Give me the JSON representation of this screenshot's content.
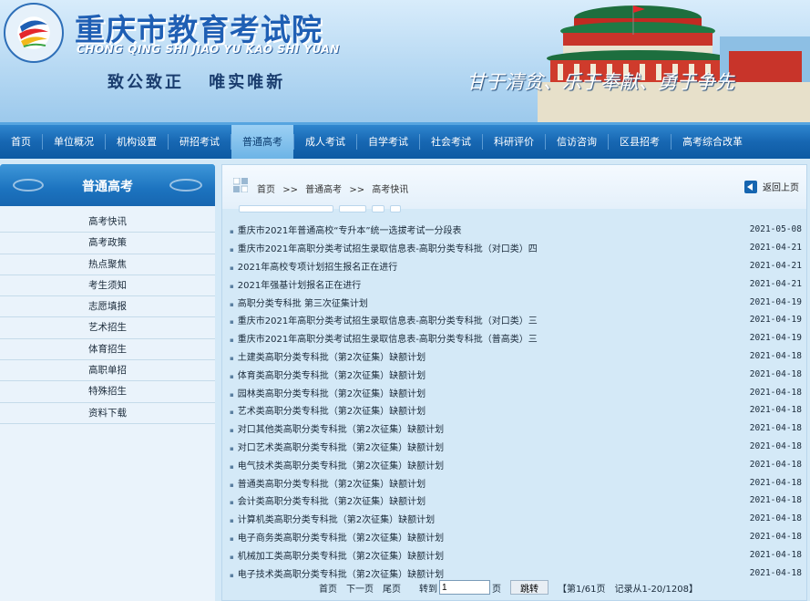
{
  "header": {
    "title": "重庆市教育考试院",
    "pinyin": "CHONG QING SHI JIAO YU KAO SHI YUAN",
    "motto_left": "致公致正 唯实唯新",
    "motto_right": "甘于清贫、乐于奉献、勇于争先"
  },
  "nav": {
    "items": [
      "首页",
      "单位概况",
      "机构设置",
      "研招考试",
      "普通高考",
      "成人考试",
      "自学考试",
      "社会考试",
      "科研评价",
      "信访咨询",
      "区县招考",
      "高考综合改革"
    ],
    "active_index": 4
  },
  "sidebar": {
    "title": "普通高考",
    "items": [
      "高考快讯",
      "高考政策",
      "热点聚焦",
      "考生须知",
      "志愿填报",
      "艺术招生",
      "体育招生",
      "高职单招",
      "特殊招生",
      "资料下载"
    ]
  },
  "breadcrumb": {
    "home": "首页",
    "sep": ">>",
    "level1": "普通高考",
    "level2": "高考快讯",
    "back_label": "返回上页"
  },
  "news": [
    {
      "title": "重庆市2021年普通高校“专升本”统一选拔考试一分段表",
      "date": "2021-05-08"
    },
    {
      "title": "重庆市2021年高职分类考试招生录取信息表-高职分类专科批（对口类）四",
      "date": "2021-04-21"
    },
    {
      "title": "2021年高校专项计划招生报名正在进行",
      "date": "2021-04-21"
    },
    {
      "title": "2021年强基计划报名正在进行",
      "date": "2021-04-21"
    },
    {
      "title": "高职分类专科批 第三次征集计划",
      "date": "2021-04-19"
    },
    {
      "title": "重庆市2021年高职分类考试招生录取信息表-高职分类专科批（对口类）三",
      "date": "2021-04-19"
    },
    {
      "title": "重庆市2021年高职分类考试招生录取信息表-高职分类专科批（普高类）三",
      "date": "2021-04-19"
    },
    {
      "title": "土建类高职分类专科批（第2次征集）缺额计划",
      "date": "2021-04-18"
    },
    {
      "title": "体育类高职分类专科批（第2次征集）缺额计划",
      "date": "2021-04-18"
    },
    {
      "title": "园林类高职分类专科批（第2次征集）缺额计划",
      "date": "2021-04-18"
    },
    {
      "title": "艺术类高职分类专科批（第2次征集）缺额计划",
      "date": "2021-04-18"
    },
    {
      "title": "对口其他类高职分类专科批（第2次征集）缺额计划",
      "date": "2021-04-18"
    },
    {
      "title": "对口艺术类高职分类专科批（第2次征集）缺额计划",
      "date": "2021-04-18"
    },
    {
      "title": "电气技术类高职分类专科批（第2次征集）缺额计划",
      "date": "2021-04-18"
    },
    {
      "title": "普通类高职分类专科批（第2次征集）缺额计划",
      "date": "2021-04-18"
    },
    {
      "title": "会计类高职分类专科批（第2次征集）缺额计划",
      "date": "2021-04-18"
    },
    {
      "title": "计算机类高职分类专科批（第2次征集）缺额计划",
      "date": "2021-04-18"
    },
    {
      "title": "电子商务类高职分类专科批（第2次征集）缺额计划",
      "date": "2021-04-18"
    },
    {
      "title": "机械加工类高职分类专科批（第2次征集）缺额计划",
      "date": "2021-04-18"
    },
    {
      "title": "电子技术类高职分类专科批（第2次征集）缺额计划",
      "date": "2021-04-18"
    }
  ],
  "pager": {
    "first": "首页",
    "next": "下一页",
    "last": "尾页",
    "goto_label": "转到",
    "page_value": "1",
    "page_unit": "页",
    "jump_label": "跳转",
    "page_info": "【第1/61页",
    "record_info": "记录从1-20/1208】"
  },
  "colors": {
    "brand_blue": "#1f5fb4",
    "nav_blue": "#1767b2",
    "nav_active": "#6db4e6",
    "content_bg": "#d4e9f7"
  }
}
